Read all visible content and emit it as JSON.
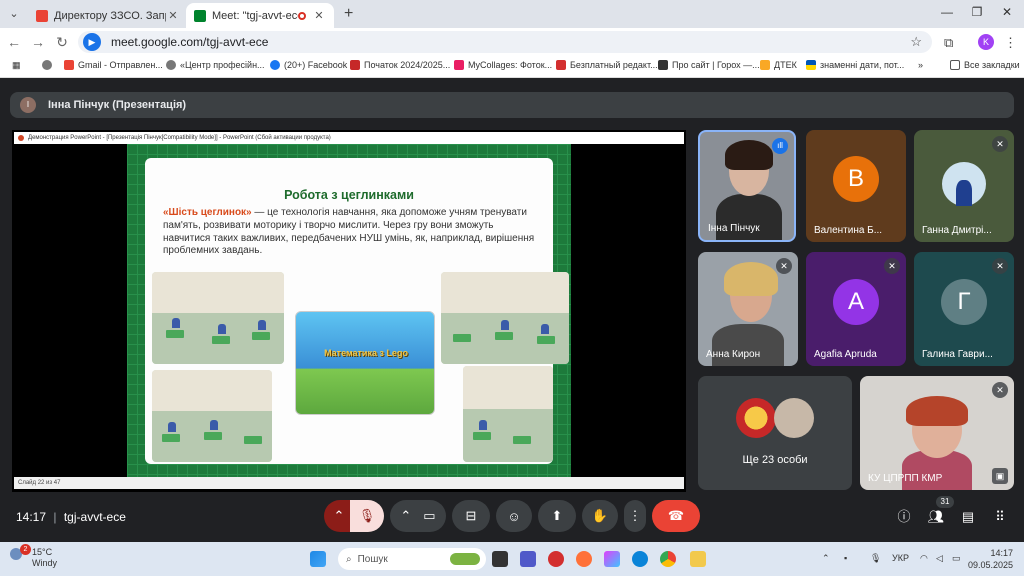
{
  "browser": {
    "tabs": [
      {
        "title": "Директору ЗЗСО. Запрошення",
        "active": false,
        "favicon_color": "#ea4335"
      },
      {
        "title": "Meet: \"tgj-avvt-ece\"",
        "active": true,
        "favicon_color": "#00832d"
      }
    ],
    "url": "meet.google.com/tgj-avvt-ece",
    "profile_initial": "K",
    "bookmarks": [
      "Gmail - Отправлен...",
      "«Центр професійн...",
      "(20+) Facebook",
      "Початок 2024/2025...",
      "MyCollages: Фоток...",
      "Безплатный редакт...",
      "Про сайт | Горох —...",
      "ДТЕК",
      "знаменні дати, пот...",
      "Все закладки"
    ]
  },
  "meet": {
    "presenter_initial": "І",
    "presenter_label": "Інна Пінчук (Презентація)",
    "meeting_time": "14:17",
    "meeting_code": "tgj-avvt-ece",
    "people_count": "31",
    "others_label": "Ще 23 особи",
    "participants": [
      {
        "name": "Інна Пінчук",
        "kind": "video",
        "speaking": true
      },
      {
        "name": "Валентина Б...",
        "kind": "avatar",
        "letter": "В",
        "color": "#e8710a",
        "bg": "#5f3b1d"
      },
      {
        "name": "Ганна Дмитрі...",
        "kind": "photo",
        "muted": true
      },
      {
        "name": "Анна Кирон",
        "kind": "video",
        "muted": true
      },
      {
        "name": "Agafia Apruda",
        "kind": "avatar",
        "letter": "A",
        "color": "#9334e6",
        "bg": "#4a1d6b",
        "muted": true
      },
      {
        "name": "Галина Гаври...",
        "kind": "avatar",
        "letter": "Г",
        "color": "#5f7f84",
        "bg": "#1e4a4e",
        "muted": true
      },
      {
        "name": "КУ ЦПРПП КМР",
        "kind": "video",
        "muted": true
      }
    ]
  },
  "presentation": {
    "window_title": "Демонстрация PowerPoint - [Презентація Пінчук[Compatibility Mode]] - PowerPoint (Сбой активации продукта)",
    "slide_title": "Робота з цеглинками",
    "slide_highlight": "«Шість цеглинок»",
    "slide_body": " — це технологія навчання, яка допоможе учням тренувати пам'ять, розвивати моторику і творчо мислити. Через гру вони зможуть навчитися таких важливих, передбачених НУШ умінь, як, наприклад, вирішення проблемних завдань.",
    "game_label": "Математика з Lego",
    "slide_status": "Слайд 22 из 47"
  },
  "taskbar": {
    "notification_count": "2",
    "temperature": "15°C",
    "weather_text": "Windy",
    "search_placeholder": "Пошук",
    "language": "УКР",
    "time": "14:17",
    "date": "09.05.2025"
  }
}
